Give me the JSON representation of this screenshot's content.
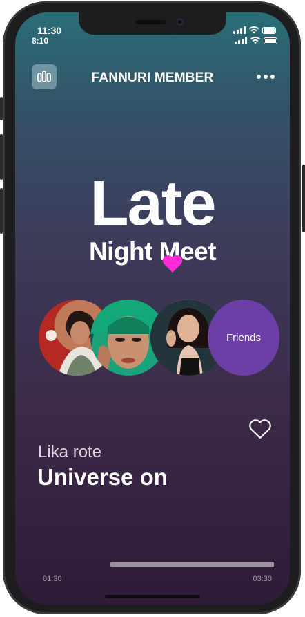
{
  "status_bar": {
    "time_primary": "11:30",
    "time_secondary": "8:10",
    "icons": [
      "signal-icon",
      "wifi-icon",
      "battery-icon"
    ]
  },
  "header": {
    "title": "FANNURI MEMBER",
    "menu_icon": "equalizer-icon",
    "more_icon": "more-dots-icon"
  },
  "hero": {
    "line1": "Late",
    "line2": "Night Meet",
    "accent_icon": "heart-icon",
    "accent_color": "#ff2bd6"
  },
  "avatars": [
    {
      "icon": "avatar-photo"
    },
    {
      "icon": "avatar-photo"
    },
    {
      "icon": "avatar-photo"
    },
    {
      "label": "Friends",
      "color": "#6b3fa6"
    }
  ],
  "track": {
    "subtitle": "Lika rote",
    "title": "Universe on",
    "like_icon": "heart-outline-icon"
  },
  "player": {
    "elapsed": "01:30",
    "total": "03:30",
    "progress": 1.0
  },
  "colors": {
    "gradient_top": "#2a6e77",
    "gradient_bottom": "#2f1b37",
    "friends_bubble": "#6b3fa6",
    "accent": "#ff2bd6"
  }
}
